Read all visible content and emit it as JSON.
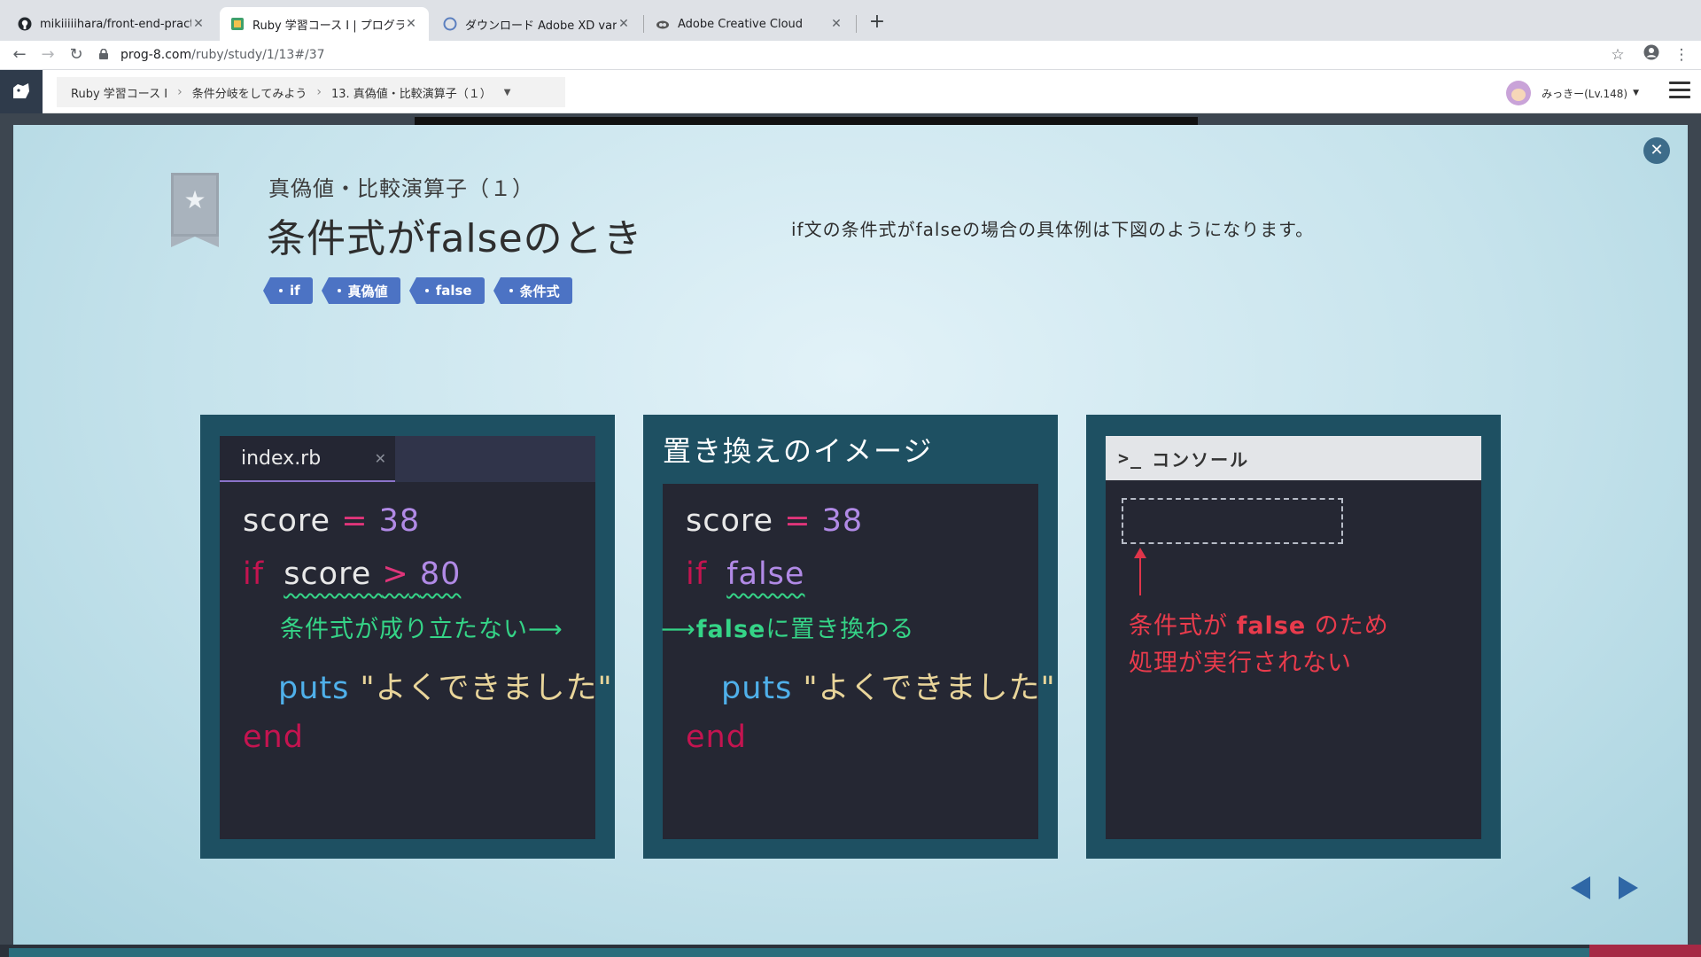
{
  "browser": {
    "tabs": [
      {
        "title": "mikiiiiihara/front-end-practice",
        "icon": "github-icon"
      },
      {
        "title": "Ruby 学習コース I | プログラミン",
        "icon": "prog8-icon"
      },
      {
        "title": "ダウンロード Adobe XD varies-v",
        "icon": "adobe-xd-icon"
      },
      {
        "title": "Adobe Creative Cloud",
        "icon": "creative-cloud-icon"
      }
    ],
    "active_tab": 1,
    "url_host": "prog-8.com",
    "url_path": "/ruby/study/1/13#/37"
  },
  "header": {
    "breadcrumb": [
      "Ruby 学習コース Ⅰ",
      "条件分岐をしてみよう",
      "13. 真偽値・比較演算子（１）"
    ],
    "user_label": "みっきー(Lv.148)"
  },
  "slide": {
    "subtitle": "真偽値・比較演算子（１）",
    "title": "条件式がfalseのとき",
    "description": "if文の条件式がfalseの場合の具体例は下図のようになります。",
    "tags": [
      "if",
      "真偽値",
      "false",
      "条件式"
    ],
    "editor": {
      "filename": "index.rb",
      "line1": {
        "var": "score",
        "op": "=",
        "num": "38"
      },
      "line2": {
        "kw": "if",
        "var": "score",
        "op": ">",
        "num": "80"
      },
      "note": "条件式が成り立たない",
      "line3": {
        "fn": "puts",
        "str": "\"よくできました\""
      },
      "line4": "end"
    },
    "replace": {
      "title": "置き換えのイメージ",
      "line1": {
        "var": "score",
        "op": "=",
        "num": "38"
      },
      "line2": {
        "kw": "if",
        "val": "false"
      },
      "note_bold": "false",
      "note_rest": "に置き換わる",
      "line3": {
        "fn": "puts",
        "str": "\"よくできました\""
      },
      "line4": "end"
    },
    "console": {
      "title": "コンソール",
      "prompt": ">_",
      "note_line1_a": "条件式が",
      "note_line1_b": "false",
      "note_line1_c": "のため",
      "note_line2": "処理が実行されない"
    }
  },
  "colors": {
    "panel": "#1e5062",
    "editor_bg": "#252733",
    "tag": "#4c73c4",
    "accent_green": "#35d487",
    "accent_red": "#e93b4c",
    "keyword_red": "#c41450",
    "number_purple": "#b18ae6"
  }
}
